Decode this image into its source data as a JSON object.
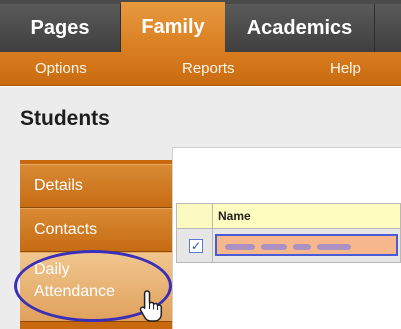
{
  "top_tabs": [
    "Pages",
    "Family",
    "Academics"
  ],
  "active_top_tab": "Family",
  "sub_menu": [
    "Options",
    "Reports",
    "Help"
  ],
  "page_title": "Students",
  "left_nav": [
    {
      "label": "Details"
    },
    {
      "label": "Contacts"
    },
    {
      "label_line1": "Daily",
      "label_line2": "Attendance"
    }
  ],
  "grid": {
    "header_name": "Name",
    "row": {
      "checked": true,
      "checkbox_glyph": "✓"
    }
  },
  "colors": {
    "accent_orange": "#d87c1f",
    "dark_tab": "#4b4b4b",
    "annotation_ellipse": "#3a2fb8",
    "selected_row_fill": "#f7b78c"
  }
}
